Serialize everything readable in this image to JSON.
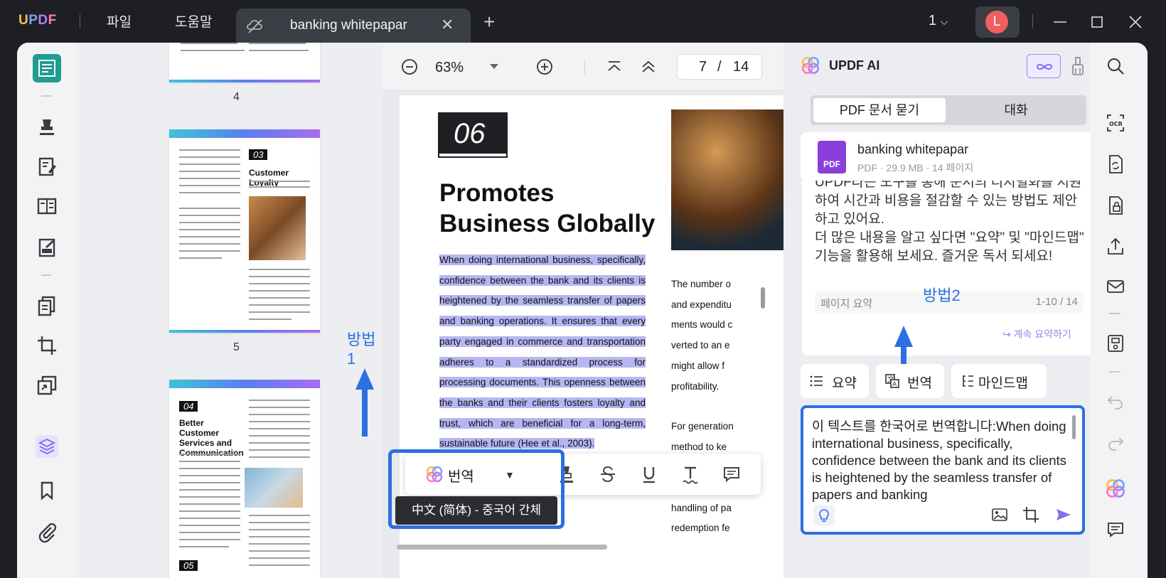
{
  "titlebar": {
    "logo": "UPDF",
    "menu": [
      "파일",
      "도움말"
    ],
    "tab_title": "banking whitepapar",
    "tab_count": "1",
    "avatar_initial": "L"
  },
  "left_tools": [
    "reader-icon",
    "comment-icon",
    "edit-icon",
    "page-layout-icon",
    "form-icon",
    "organize-icon",
    "crop-icon",
    "convert-icon",
    "layers-icon",
    "bookmark-icon",
    "attachment-icon"
  ],
  "thumbnails": {
    "pages": [
      {
        "number": "4"
      },
      {
        "number": "5",
        "section": "03",
        "heading": "Customer Loyalty"
      },
      {
        "section": "04",
        "heading": "Better Customer Services and Communication",
        "next_section": "05"
      }
    ],
    "method1_label": "방법1"
  },
  "doc_toolbar": {
    "zoom": "63%",
    "current_page": "7",
    "page_sep": "/",
    "total_pages": "14"
  },
  "document": {
    "section_number": "06",
    "title": "Promotes Business Globally",
    "body_paragraph": "When doing international business, specifically, confidence between the bank and its clients is heightened by the seamless transfer of papers and banking operations. It ensures that every party engaged in commerce and transportation adheres to a standardized process for processing documents. This openness between the banks and their clients fosters loyalty and trust, which are beneficial for a long-term, sustainable future (Hee et al., 2003).",
    "col2_lines_a": [
      "The number o",
      "and expenditu",
      "ments would c",
      "verted to an e",
      "might allow f",
      "profitability."
    ],
    "col2_lines_b": [
      "For generation",
      "method to ke",
      "",
      "",
      "handling of pa",
      "redemption fe"
    ]
  },
  "float_toolbar": {
    "translate_label": "번역",
    "tooltip": "中文 (简体) - 중국어 간체",
    "tools": [
      "highlight-icon",
      "strikethrough-icon",
      "underline-icon",
      "squiggly-icon",
      "comment-icon"
    ]
  },
  "ai_panel": {
    "title": "UPDF AI",
    "tab_active": "PDF 문서 묻기",
    "tab_inactive": "대화",
    "file_name": "banking whitepapar",
    "file_meta": "PDF · 29.9 MB · 14 페이지",
    "file_badge": "PDF",
    "chat_text": "UPDF라는 도구를 통해 문서의 디지털화를 지원하여 시간과 비용을 절감할 수 있는 방법도 제안하고 있어요.\n더 많은 내용을 알고 싶다면 \"요약\" 및 \"마인드맵\" 기능을 활용해 보세요. 즐거운 독서 되세요!",
    "summary_label": "페이지 요약",
    "summary_range": "1-10 / 14",
    "continue_label": "계속 요약하기",
    "method2_label": "방법2",
    "chips": [
      "요약",
      "번역",
      "마인드맵"
    ],
    "input_text": "이 텍스트를 한국어로 번역합니다:When doing international business, specifically, confidence between the bank and its clients is heightened by the seamless transfer of papers and banking"
  },
  "right_rail": [
    "search-icon",
    "ocr-icon",
    "convert-icon",
    "protect-icon",
    "share-icon",
    "email-icon",
    "save-icon",
    "undo-icon",
    "redo-icon",
    "updf-ai-icon",
    "comments-icon"
  ],
  "colors": {
    "accent_blue": "#2d6fe0",
    "highlight": "#b5b6f3",
    "brand_purple": "#8a3fdc",
    "active_tool": "#1f9d8f"
  }
}
